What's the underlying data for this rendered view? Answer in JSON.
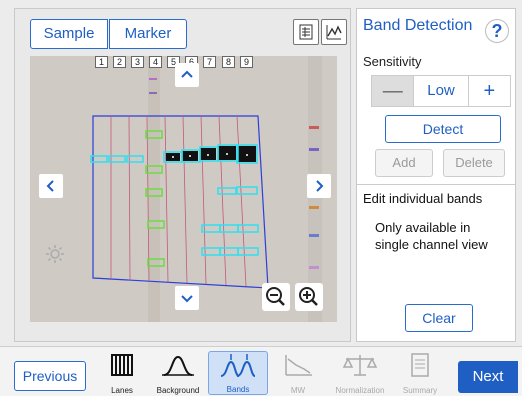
{
  "left_panel": {
    "tabs": {
      "sample": "Sample",
      "marker": "Marker"
    },
    "lane_numbers": [
      "1",
      "2",
      "3",
      "4",
      "5",
      "6",
      "7",
      "8",
      "9"
    ]
  },
  "right_panel": {
    "title": "Band Detection",
    "help_symbol": "?",
    "sensitivity_label": "Sensitivity",
    "stepper": {
      "minus_label": "—",
      "value": "Low",
      "plus_label": "+"
    },
    "detect_label": "Detect",
    "add_label": "Add",
    "delete_label": "Delete",
    "info_heading": "Edit individual bands",
    "info_body": "Only available in single channel view",
    "clear_label": "Clear"
  },
  "footer": {
    "previous_label": "Previous",
    "next_label": "Next",
    "steps": [
      {
        "label": "Lanes",
        "icon": "lanes-icon",
        "state": "normal"
      },
      {
        "label": "Background",
        "icon": "background-icon",
        "state": "normal"
      },
      {
        "label": "Bands",
        "icon": "bands-icon",
        "state": "active"
      },
      {
        "label": "MW",
        "icon": "mw-icon",
        "state": "disabled"
      },
      {
        "label": "Normalization",
        "icon": "normalization-icon",
        "state": "disabled"
      },
      {
        "label": "Summary",
        "icon": "summary-icon",
        "state": "disabled"
      }
    ]
  },
  "colors": {
    "accent": "#1f5fc4",
    "band_highlight": "#2fe0f0",
    "band_selected": "#6bdc3f"
  }
}
